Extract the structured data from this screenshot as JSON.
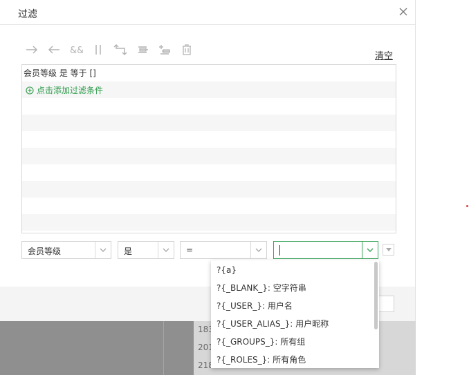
{
  "dialog": {
    "title": "过滤",
    "clear_label": "清空",
    "toolbar_icons": [
      "arrow-right-icon",
      "arrow-left-icon",
      "and-icon",
      "or-icon",
      "swap-icon",
      "indent-icon",
      "outdent-icon",
      "trash-icon"
    ]
  },
  "conditions": {
    "items": [
      "会员等级 是 等于 []"
    ],
    "add_label": "点击添加过滤条件"
  },
  "editor": {
    "field_value": "会员等级",
    "operator1_value": "是",
    "operator2_value": "=",
    "value_input": ""
  },
  "dropdown": {
    "options": [
      "?{a}",
      "?{_BLANK_}: 空字符串",
      "?{_USER_}: 用户名",
      "?{_USER_ALIAS_}: 用户昵称",
      "?{_GROUPS_}: 所有组",
      "?{_ROLES_}: 所有角色"
    ]
  },
  "background": {
    "row_numbers": [
      "183",
      "201",
      "218"
    ]
  },
  "colors": {
    "accent": "#2d9b4a",
    "border": "#d8d8d8"
  }
}
